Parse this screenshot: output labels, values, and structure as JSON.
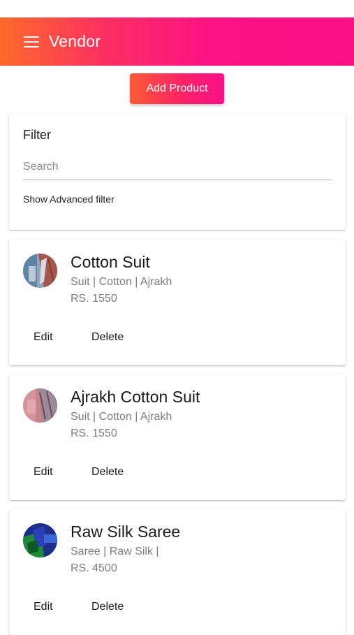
{
  "app_bar": {
    "title": "Vendor",
    "menu_icon": "hamburger-menu-icon"
  },
  "add_button": {
    "label": "Add Product"
  },
  "filter": {
    "title": "Filter",
    "search_placeholder": "Search",
    "search_value": "",
    "advanced_label": "Show Advanced filter"
  },
  "products": [
    {
      "name": "Cotton Suit",
      "categories": "Suit | Cotton | Ajrakh",
      "price": "RS. 1550",
      "edit_label": "Edit",
      "delete_label": "Delete"
    },
    {
      "name": "Ajrakh Cotton Suit",
      "categories": "Suit | Cotton | Ajrakh",
      "price": "RS. 1550",
      "edit_label": "Edit",
      "delete_label": "Delete"
    },
    {
      "name": "Raw Silk Saree",
      "categories": "Saree | Raw Silk |",
      "price": "RS. 4500",
      "edit_label": "Edit",
      "delete_label": "Delete"
    }
  ],
  "colors": {
    "gradient_start": "#ff6a2a",
    "gradient_end": "#fb0f86"
  }
}
